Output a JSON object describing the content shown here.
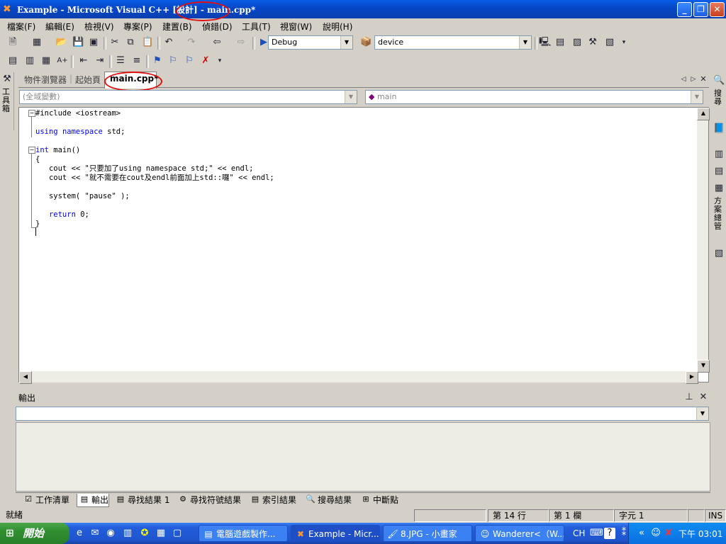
{
  "window": {
    "title_prefix": "Example - Microsoft Visual C++ [設計] -",
    "title_file": "main.cpp*",
    "minimize": "_",
    "restore": "❐",
    "close": "✕"
  },
  "menu": [
    "檔案(F)",
    "編輯(E)",
    "檢視(V)",
    "專案(P)",
    "建置(B)",
    "偵錯(D)",
    "工具(T)",
    "視窗(W)",
    "說明(H)"
  ],
  "toolbar": {
    "config": "Debug",
    "device": "device"
  },
  "tabs": {
    "object_browser": "物件瀏覽器",
    "start_page": "起始頁",
    "active": "main.cpp*"
  },
  "scope_combo": "(全域變數)",
  "member_combo": "main",
  "code": [
    {
      "text": "#include <iostream>",
      "parts": [
        [
          "",
          "#include <iostream>"
        ]
      ]
    },
    {
      "text": ""
    },
    {
      "parts": [
        [
          "kw",
          "using"
        ],
        [
          "",
          " "
        ],
        [
          "kw",
          "namespace"
        ],
        [
          "",
          " std;"
        ]
      ]
    },
    {
      "text": ""
    },
    {
      "parts": [
        [
          "kw",
          "int"
        ],
        [
          "",
          " main()"
        ]
      ]
    },
    {
      "parts": [
        [
          "",
          "{"
        ]
      ]
    },
    {
      "parts": [
        [
          "",
          "   cout << \"只要加了using namespace std;\" << endl;"
        ]
      ]
    },
    {
      "parts": [
        [
          "",
          "   cout << \"就不需要在cout及endl前面加上std::囉\" << endl;"
        ]
      ]
    },
    {
      "text": ""
    },
    {
      "parts": [
        [
          "",
          "   system( \"pause\" );"
        ]
      ]
    },
    {
      "text": ""
    },
    {
      "parts": [
        [
          "",
          "   "
        ],
        [
          "kw",
          "return"
        ],
        [
          "",
          " 0;"
        ]
      ]
    },
    {
      "parts": [
        [
          "",
          "}"
        ]
      ]
    }
  ],
  "left_dock": "工具箱",
  "right_dock": {
    "search": "搜尋",
    "solution": "方案總管"
  },
  "output": {
    "title": "輸出",
    "pin": "ꟷ",
    "close": "✕"
  },
  "bottom_tabs": [
    "工作清單",
    "輸出",
    "尋找結果 1",
    "尋找符號結果",
    "索引結果",
    "搜尋結果",
    "中斷點"
  ],
  "status": {
    "text": "就緒",
    "line": "第 14 行",
    "col": "第 1 欄",
    "ch": "字元 1",
    "ins": "INS"
  },
  "taskbar": {
    "start": "開始",
    "tasks": [
      "電腦遊戲製作...",
      "Example - Micr...",
      "8.JPG - 小畫家",
      "Wanderer<（W..."
    ],
    "lang": "CH",
    "clock": "下午 03:01"
  }
}
